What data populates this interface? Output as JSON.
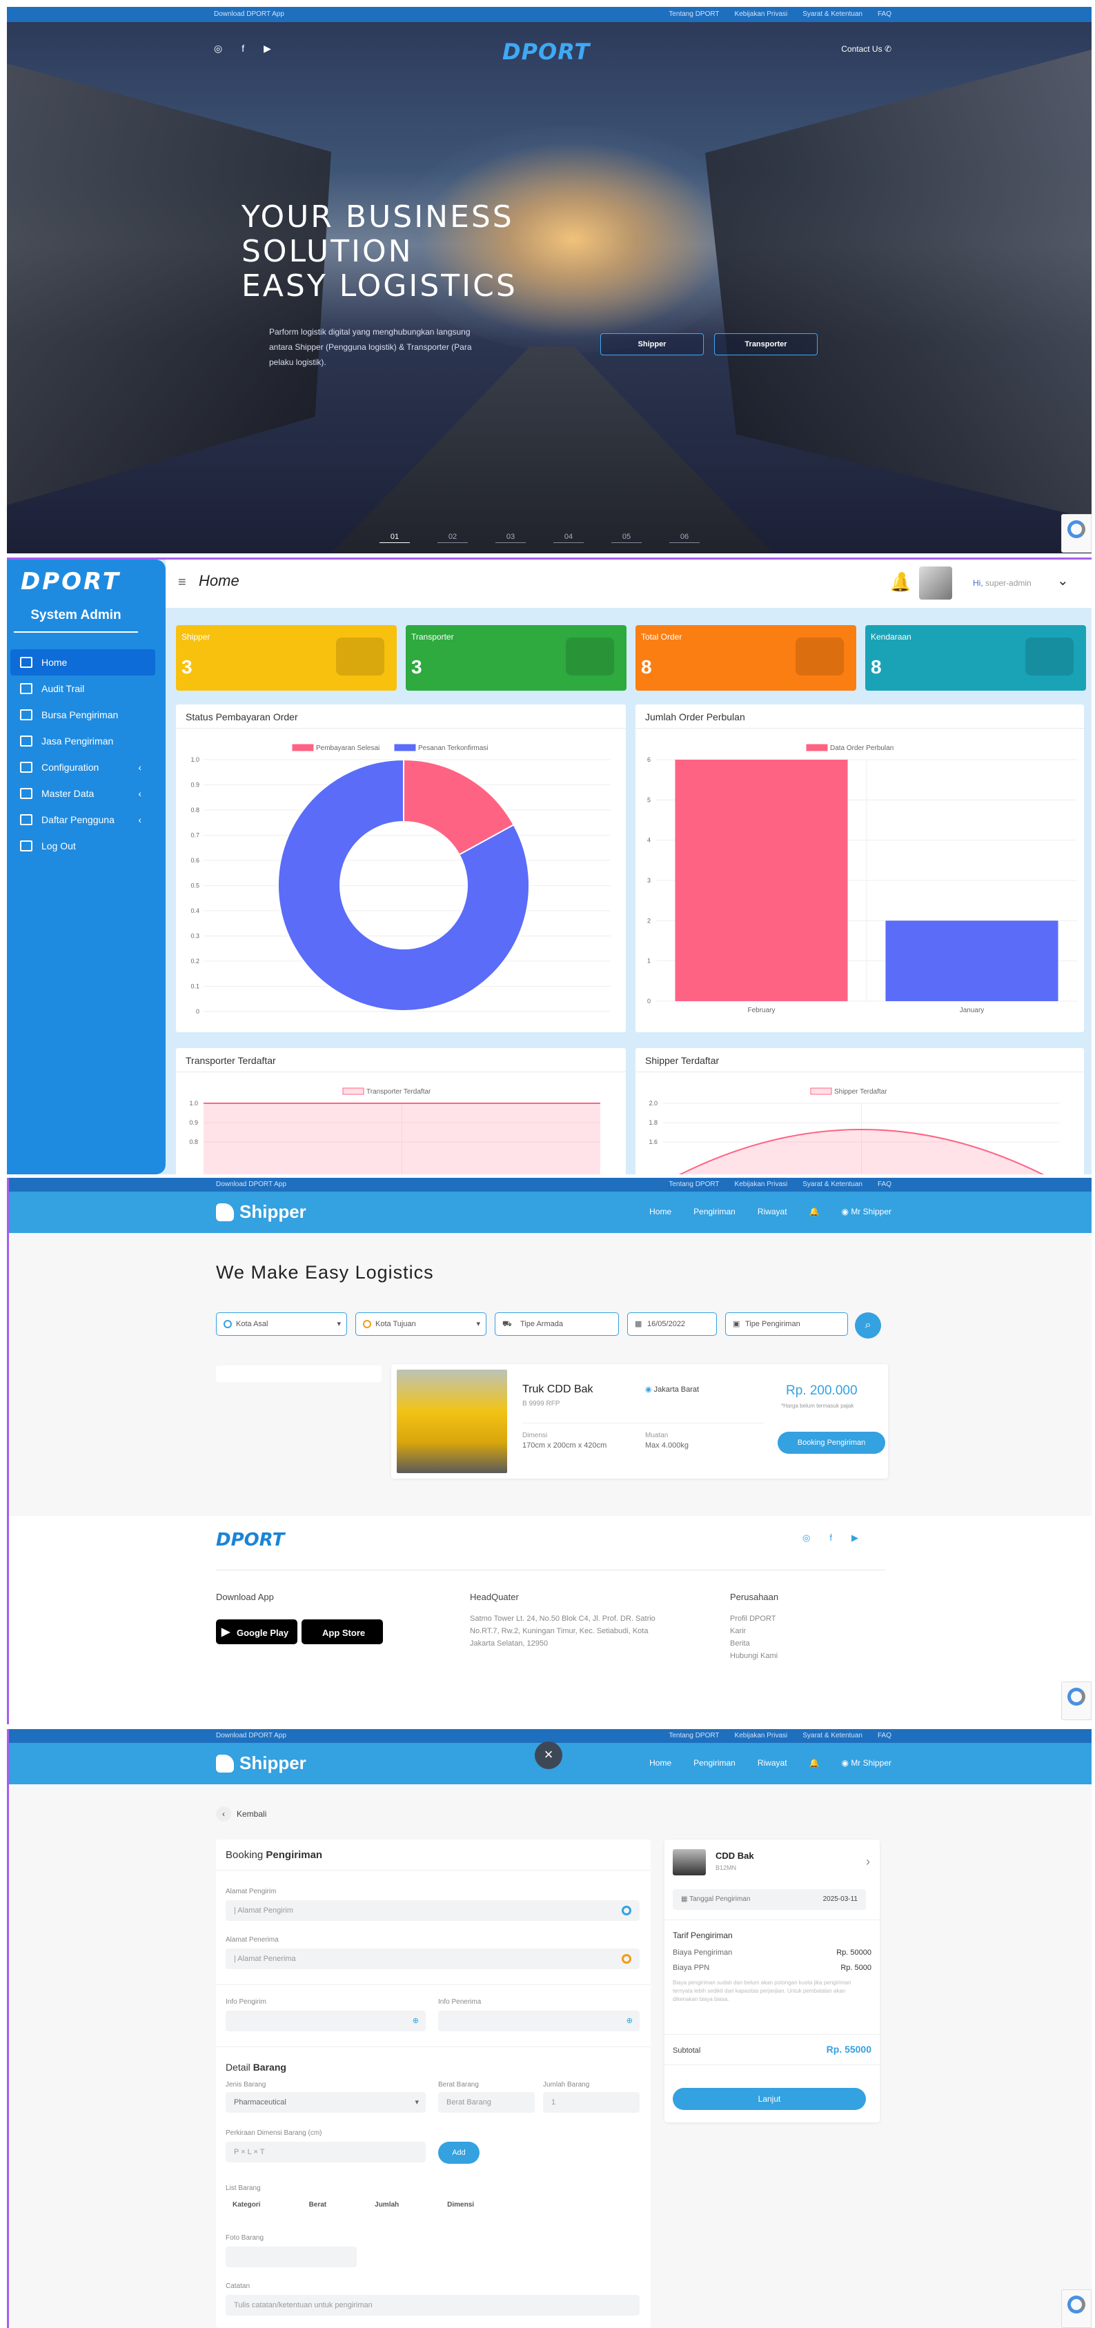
{
  "landing": {
    "download_app": "Download DPORT App",
    "top_links": [
      "Tentang DPORT",
      "Kebijakan Privasi",
      "Syarat & Ketentuan",
      "FAQ"
    ],
    "social_icons": [
      "instagram-icon",
      "facebook-icon",
      "youtube-icon"
    ],
    "brand": "DPORT",
    "contact": "Contact Us",
    "hero_title_1": "YOUR BUSINESS",
    "hero_title_2": "SOLUTION",
    "hero_title_3": "EASY LOGISTICS",
    "hero_desc": "Parform logistik digital yang menghubungkan langsung antara Shipper (Pengguna logistik) & Transporter (Para pelaku logistik).",
    "btn_shipper": "Shipper",
    "btn_transporter": "Transporter",
    "pager": [
      "01",
      "02",
      "03",
      "04",
      "05",
      "06"
    ]
  },
  "admin": {
    "brand": "DPORT",
    "system_title": "System Admin",
    "menu": [
      {
        "label": "Home",
        "active": true,
        "chevron": ""
      },
      {
        "label": "Audit Trail",
        "active": false,
        "chevron": ""
      },
      {
        "label": "Bursa Pengiriman",
        "active": false,
        "chevron": ""
      },
      {
        "label": "Jasa Pengiriman",
        "active": false,
        "chevron": ""
      },
      {
        "label": "Configuration",
        "active": false,
        "chevron": "‹"
      },
      {
        "label": "Master Data",
        "active": false,
        "chevron": "‹"
      },
      {
        "label": "Daftar Pengguna",
        "active": false,
        "chevron": "‹"
      },
      {
        "label": "Log Out",
        "active": false,
        "chevron": ""
      }
    ],
    "page_title": "Home",
    "greeting_hi": "Hi,",
    "greeting_user": "super-admin",
    "cards": [
      {
        "label": "Shipper",
        "value": "3",
        "color": "#f8c10e"
      },
      {
        "label": "Transporter",
        "value": "3",
        "color": "#2eaa3f"
      },
      {
        "label": "Total Order",
        "value": "8",
        "color": "#fb7e12"
      },
      {
        "label": "Kendaraan",
        "value": "8",
        "color": "#1aa3b6"
      }
    ],
    "box_status": "Status Pembayaran Order",
    "box_monthly": "Jumlah Order Perbulan",
    "box_transporter": "Transporter Terdaftar",
    "box_shipper": "Shipper Terdaftar"
  },
  "chart_data": [
    {
      "type": "pie",
      "title": "Status Pembayaran Order",
      "categories": [
        "Pembayaran Selesai",
        "Pesanan Terkonfirmasi"
      ],
      "values": [
        0.17,
        0.83
      ],
      "colors": [
        "#ff6384",
        "#5a6cf8"
      ],
      "y_ticks": [
        "1.0",
        "0.9",
        "0.8",
        "0.7",
        "0.6",
        "0.5",
        "0.4",
        "0.3",
        "0.2",
        "0.1",
        "0"
      ],
      "legend": "top"
    },
    {
      "type": "bar",
      "title": "Jumlah Order Perbulan",
      "categories": [
        "February",
        "January"
      ],
      "series": [
        {
          "name": "Data Order Perbulan",
          "values": [
            6,
            2
          ]
        }
      ],
      "colors": [
        "#ff6384",
        "#5a6cf8"
      ],
      "ylim": [
        0,
        6
      ],
      "y_ticks": [
        "6",
        "5",
        "4",
        "3",
        "2",
        "1",
        "0"
      ],
      "legend": "top"
    },
    {
      "type": "area",
      "title": "Transporter Terdaftar",
      "series": [
        {
          "name": "Transporter Terdaftar",
          "values": [
            1.0,
            1.0
          ]
        }
      ],
      "y_ticks": [
        "1.0",
        "0.9",
        "0.8"
      ],
      "legend": "top"
    },
    {
      "type": "area",
      "title": "Shipper Terdaftar",
      "series": [
        {
          "name": "Shipper Terdaftar",
          "values": [
            1.6,
            2.0,
            1.6
          ]
        }
      ],
      "y_ticks": [
        "2.0",
        "1.8",
        "1.6"
      ],
      "legend": "top"
    }
  ],
  "shipper": {
    "download_app": "Download DPORT App",
    "top_links": [
      "Tentang DPORT",
      "Kebijakan Privasi",
      "Syarat & Ketentuan",
      "FAQ"
    ],
    "brand": "Shipper",
    "nav": [
      "Home",
      "Pengiriman",
      "Riwayat"
    ],
    "user": "Mr Shipper",
    "title": "We Make Easy Logistics",
    "filters": [
      "Kota Asal",
      "Kota Tujuan",
      "Tipe Armada",
      "16/05/2022",
      "Tipe Pengiriman"
    ],
    "result": {
      "name": "Truk CDD Bak",
      "plate": "B 9999 RFP",
      "location": "Jakarta Barat",
      "price": "Rp. 200.000",
      "price_note": "*Harga belum termasuk pajak",
      "dim_label": "Dimensi",
      "dim_value": "170cm x 200cm x 420cm",
      "load_label": "Muatan",
      "load_value": "Max 4.000kg",
      "button": "Booking Pengiriman"
    },
    "footer": {
      "brand": "DPORT",
      "download_label": "Download App",
      "google_play": "Google Play",
      "app_store": "App Store",
      "hq_label": "HeadQuater",
      "hq_address": "Satmo Tower Lt. 24, No.50 Blok C4, Jl. Prof. DR. Satrio No.RT.7, Rw.2, Kuningan Timur, Kec. Setiabudi, Kota Jakarta Selatan, 12950",
      "company_label": "Perusahaan",
      "company_links": [
        "Profil DPORT",
        "Karir",
        "Berita",
        "Hubungi Kami"
      ]
    }
  },
  "booking": {
    "back": "Kembali",
    "title_1": "Booking",
    "title_2": "Pengiriman",
    "alamat_pengirim_label": "Alamat Pengirim",
    "alamat_pengirim_ph": "| Alamat Pengirim",
    "alamat_penerima_label": "Alamat Penerima",
    "alamat_penerima_ph": "| Alamat Penerima",
    "info_pengirim": "Info Pengirim",
    "info_penerima": "Info Penerima",
    "detail_1": "Detail",
    "detail_2": "Barang",
    "jenis_label": "Jenis Barang",
    "jenis_value": "Pharmaceutical",
    "berat_label": "Berat Barang",
    "berat_ph": "Berat Barang",
    "jumlah_label": "Jumlah Barang",
    "jumlah_value": "1",
    "dimensi_label": "Perkiraan Dimensi Barang (cm)",
    "dimensi_ph": "P          ×   L          ×   T",
    "add": "Add",
    "list_label": "List Barang",
    "list_headers": [
      "Kategori",
      "Berat",
      "Jumlah",
      "Dimensi"
    ],
    "foto_label": "Foto Barang",
    "catatan_label": "Catatan",
    "catatan_ph": "Tulis catatan/ketentuan untuk pengiriman",
    "vehicle_name": "CDD Bak",
    "vehicle_plate": "B12MN",
    "tanggal_label": "Tanggal Pengiriman",
    "tanggal_value": "2025-03-11",
    "tarif_label": "Tarif Pengiriman",
    "biaya_label": "Biaya Pengiriman",
    "biaya_value": "Rp. 50000",
    "ppn_label": "Biaya PPN",
    "ppn_value": "Rp. 5000",
    "note": "Biaya pengiriman sudah dan belum akan potongan kuota jika pengiriman ternyata lebih sedikit dari kapasitas perjanjian. Untuk pembatalan akan dikenakan biaya biasa.",
    "subtotal_label": "Subtotal",
    "subtotal_value": "Rp. 55000",
    "lanjut": "Lanjut"
  }
}
